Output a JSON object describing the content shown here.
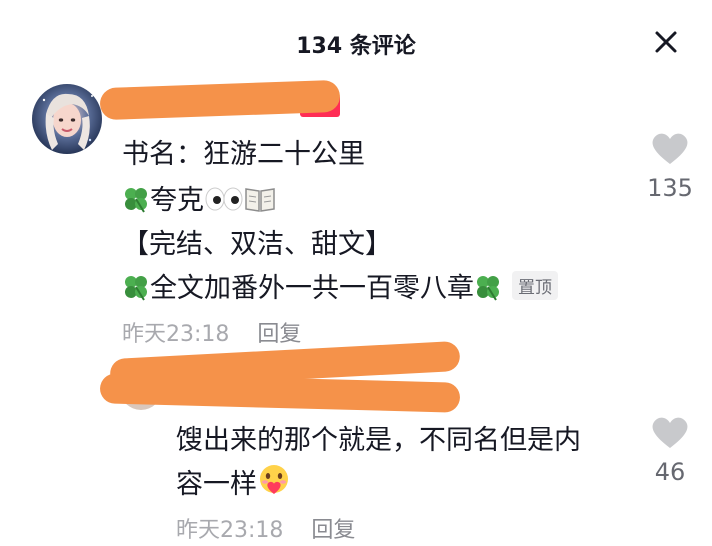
{
  "header": {
    "title": "134 条评论",
    "close_icon": "close-icon"
  },
  "comments": [
    {
      "avatar": "user-avatar",
      "name_redacted": true,
      "lines": [
        "书名：狂游二十公里",
        "夸克",
        "【完结、双洁、甜文】",
        "全文加番外一共一百零八章"
      ],
      "emojis": [
        "clover-icon",
        "eyes-icon",
        "book-icon",
        "clover-icon",
        "clover-icon"
      ],
      "pinned_label": "置顶",
      "time": "昨天23:18",
      "reply_label": "回复",
      "likes": "135"
    },
    {
      "avatar": "user-avatar",
      "name_redacted": true,
      "lines": [
        "馊出来的那个就是，不同名但是内",
        "容一样"
      ],
      "emojis": [
        "heart-face-emoji"
      ],
      "time": "昨天23:18",
      "reply_label": "回复",
      "likes": "46"
    }
  ],
  "colors": {
    "redaction": "#f5924a",
    "secondary_text": "#a8a9ae",
    "like_icon": "#c8c9cc"
  }
}
